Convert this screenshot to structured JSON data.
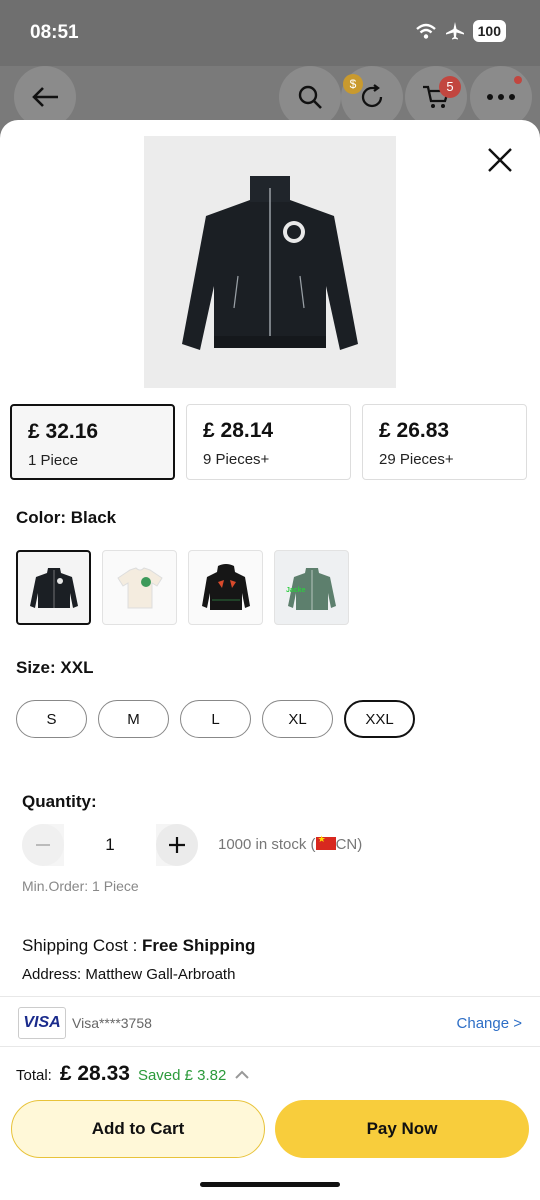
{
  "status": {
    "time": "08:51",
    "battery": "100"
  },
  "header": {
    "cart_count": "5",
    "coin": "$"
  },
  "price_tiers": [
    {
      "price": "£ 32.16",
      "quantity": "1 Piece",
      "selected": true
    },
    {
      "price": "£ 28.14",
      "quantity": "9 Pieces+",
      "selected": false
    },
    {
      "price": "£ 26.83",
      "quantity": "29 Pieces+",
      "selected": false
    }
  ],
  "color": {
    "label": "Color: Black",
    "swatch_text": "Jacke"
  },
  "size": {
    "label": "Size: XXL",
    "options": [
      "S",
      "M",
      "L",
      "XL",
      "XXL"
    ],
    "selected": "XXL"
  },
  "quantity": {
    "label": "Quantity:",
    "value": "1",
    "stock": "1000 in stock (",
    "stock_suffix": "CN)",
    "min_order": "Min.Order: 1 Piece"
  },
  "shipping": {
    "label": "Shipping Cost : ",
    "value": "Free Shipping",
    "address": "Address: Matthew  Gall-Arbroath"
  },
  "payment": {
    "brand": "VISA",
    "card": "Visa****3758",
    "change": "Change >"
  },
  "total": {
    "label": "Total:",
    "value": "£ 28.33",
    "saved": "Saved  £ 3.82"
  },
  "buttons": {
    "add_to_cart": "Add to Cart",
    "pay_now": "Pay Now"
  },
  "colors": {
    "accent": "#f8cd3c",
    "saved_green": "#2b9a3a",
    "link_blue": "#2d6ec6",
    "badge_red": "#c2463f"
  }
}
